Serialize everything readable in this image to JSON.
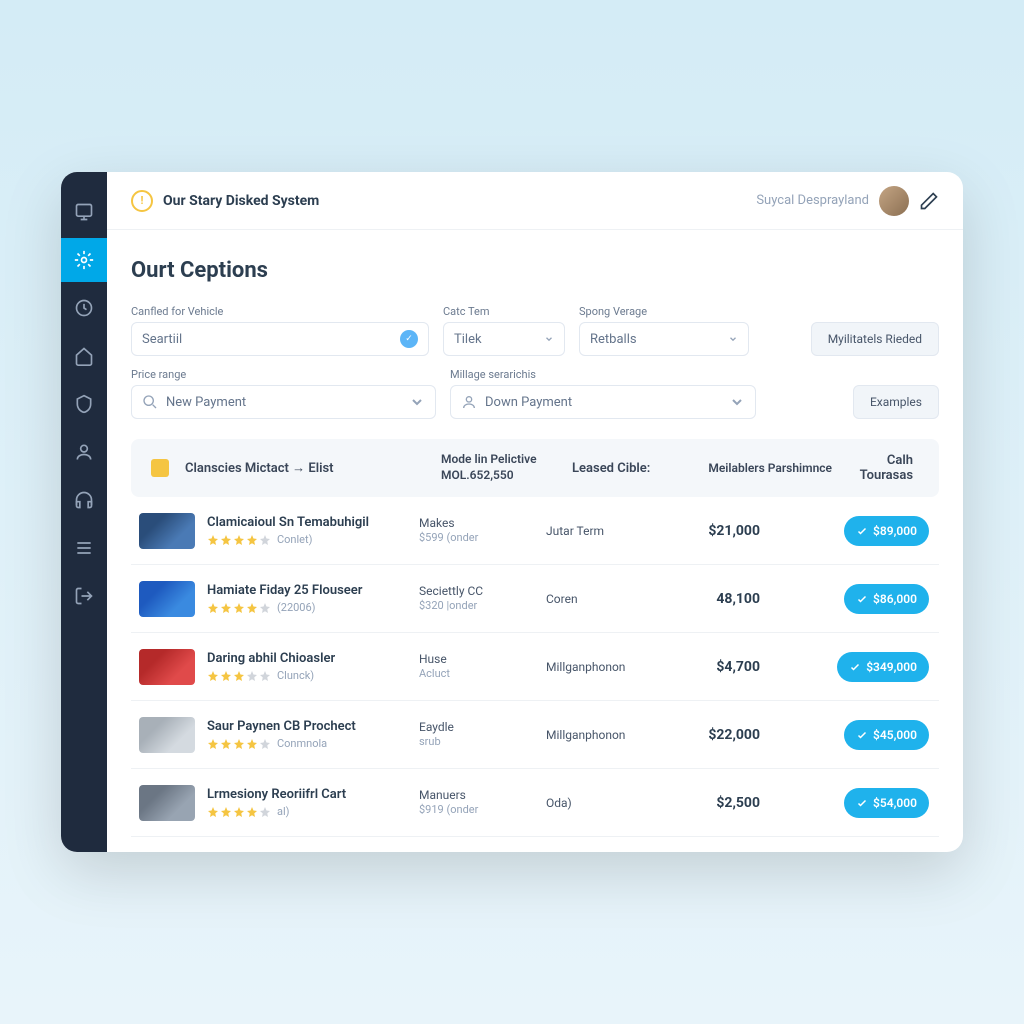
{
  "header": {
    "app_title": "Our Stary Disked System",
    "username": "Suycal Desprayland"
  },
  "page_title": "Ourt Ceptions",
  "filters": {
    "vehicle_label": "Canfled for Vehicle",
    "vehicle_placeholder": "Seartiil",
    "term_label": "Catc Tem",
    "term_value": "Tilek",
    "range_label": "Spong Verage",
    "range_value": "Retballs",
    "recent_button": "Myilitatels Rieded",
    "price_label": "Price range",
    "price_value": "New Payment",
    "mileage_label": "Millage serarichis",
    "mileage_value": "Down Payment",
    "examples_button": "Examples"
  },
  "table": {
    "header": {
      "col1": "Clanscies Mictact → Elist",
      "col2_line1": "Mode lin Pelictive",
      "col2_line2": "MOL.652,550",
      "col3": "Leased Cible:",
      "col4": "Meilablers Parshimnce",
      "col5": "Calh Tourasas"
    },
    "rows": [
      {
        "title": "Clamicaioul Sn Temabuhigil",
        "stars": 4,
        "stars_label": "Conlet)",
        "make": "Makes",
        "make_sub": "$599 (onder",
        "lease": "Jutar Term",
        "price": "$21,000",
        "action": "$89,000",
        "thumb": "blue"
      },
      {
        "title": "Hamiate Fiday 25 Flouseer",
        "stars": 4,
        "stars_label": "(22006)",
        "make": "Seciettly CC",
        "make_sub": "$320 |onder",
        "lease": "Coren",
        "price": "48,100",
        "action": "$86,000",
        "thumb": "bblue"
      },
      {
        "title": "Daring abhil Chioasler",
        "stars": 3,
        "stars_label": "Clunck)",
        "make": "Huse",
        "make_sub": "Acluct",
        "lease": "Millganphonon",
        "price": "$4,700",
        "action": "$349,000",
        "thumb": "red"
      },
      {
        "title": "Saur Paynen CB Prochect",
        "stars": 4,
        "stars_label": "Conmnola",
        "make": "Eaydle",
        "make_sub": "srub",
        "lease": "Millganphonon",
        "price": "$22,000",
        "action": "$45,000",
        "thumb": "silver"
      },
      {
        "title": "Lrmesiony Reoriifrl Cart",
        "stars": 4,
        "stars_label": "al)",
        "make": "Manuers",
        "make_sub": "$919 (onder",
        "lease": "Oda)",
        "price": "$2,500",
        "action": "$54,000",
        "thumb": "grey"
      }
    ]
  }
}
